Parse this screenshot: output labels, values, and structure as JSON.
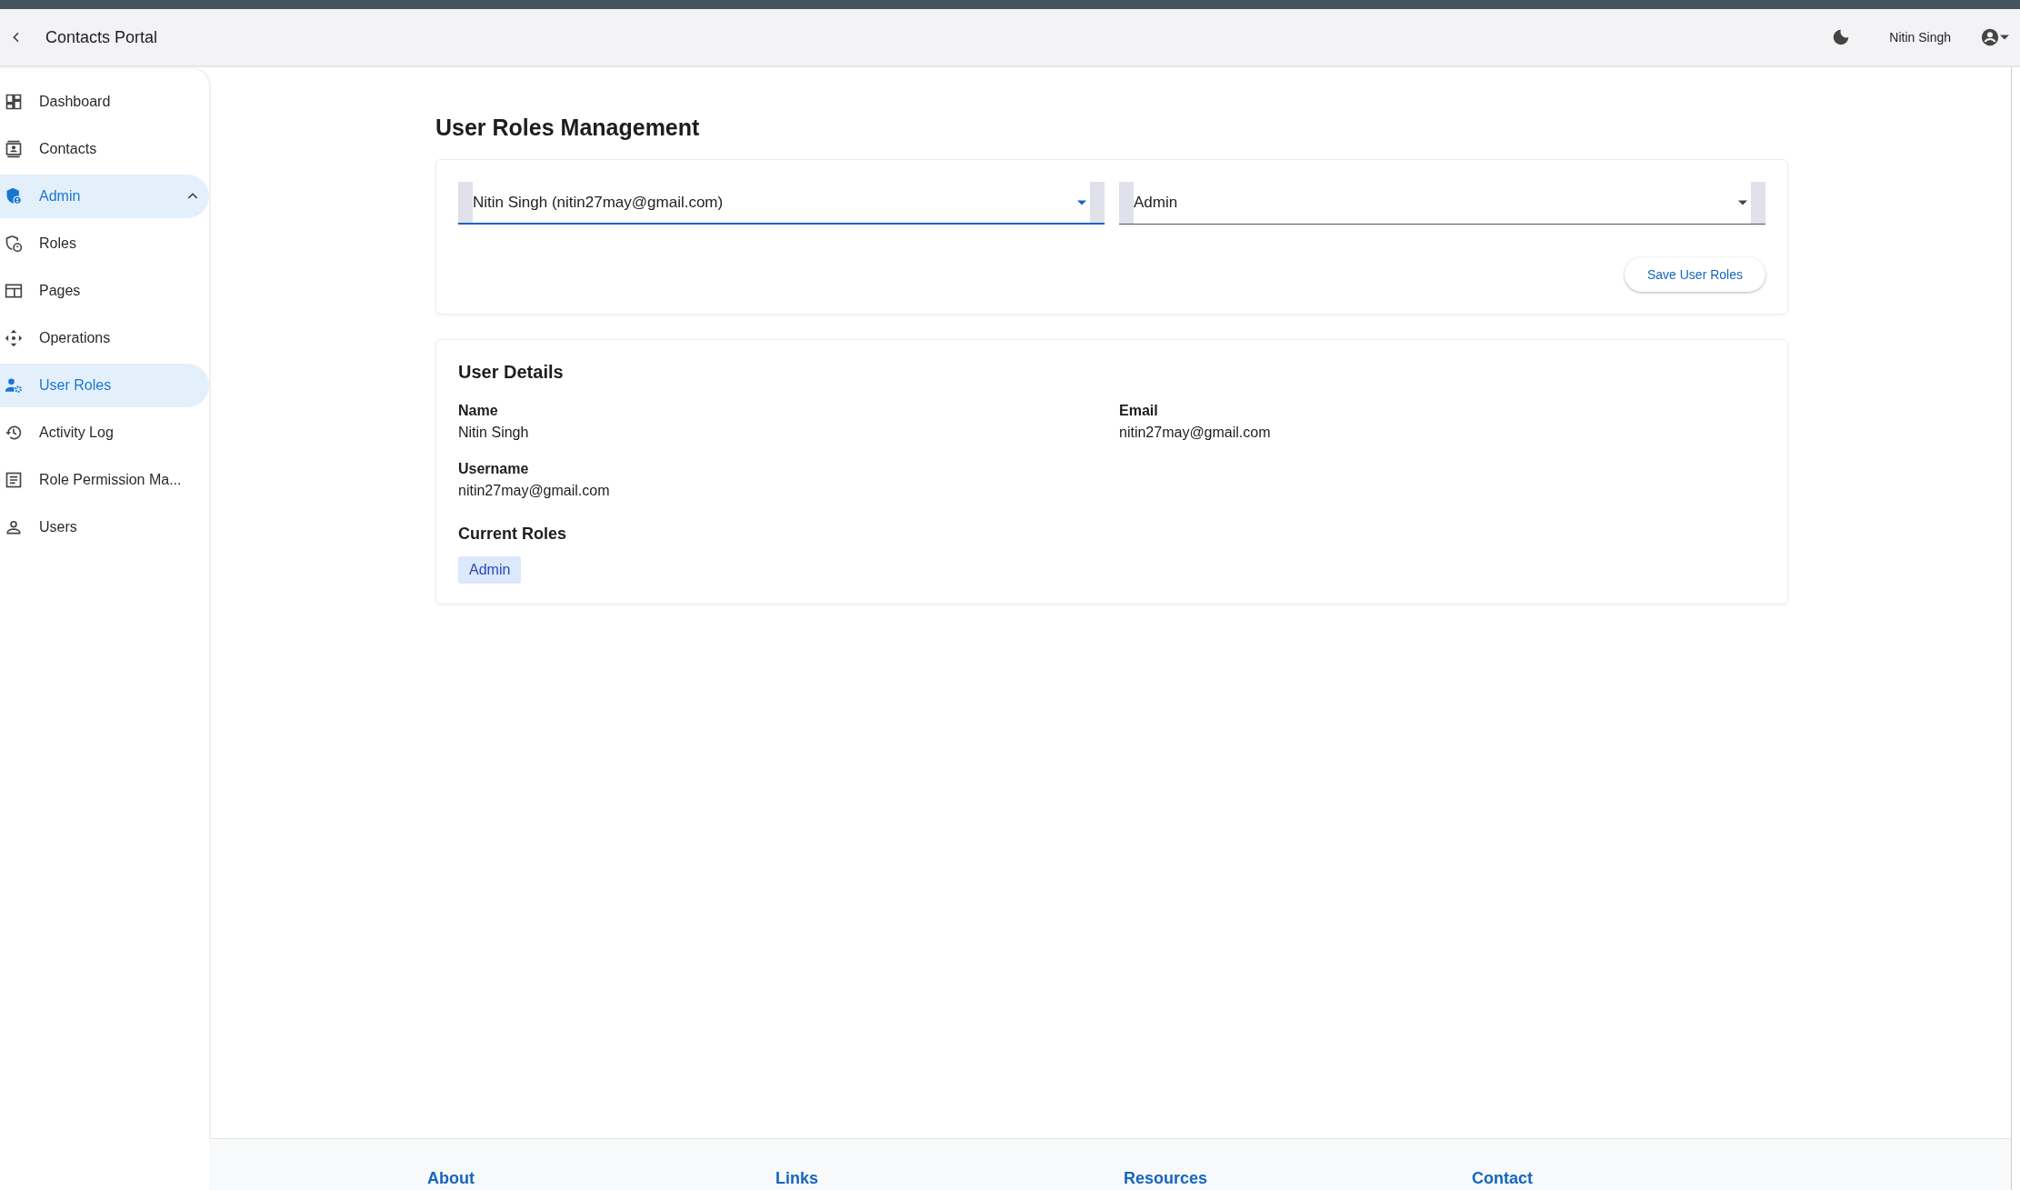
{
  "header": {
    "title": "Contacts Portal",
    "user_name": "Nitin Singh"
  },
  "sidebar": {
    "items": [
      {
        "label": "Dashboard",
        "selected": false
      },
      {
        "label": "Contacts",
        "selected": false
      },
      {
        "label": "Admin",
        "selected": true,
        "expanded": true,
        "children": [
          {
            "label": "Roles",
            "selected": false
          },
          {
            "label": "Pages",
            "selected": false
          },
          {
            "label": "Operations",
            "selected": false
          },
          {
            "label": "User Roles",
            "selected": true
          },
          {
            "label": "Activity Log",
            "selected": false
          },
          {
            "label": "Role Permission Ma...",
            "selected": false
          },
          {
            "label": "Users",
            "selected": false
          }
        ]
      }
    ]
  },
  "page_title": "User Roles Management",
  "form": {
    "selects": [
      {
        "value": "Nitin Singh (nitin27may@gmail.com)",
        "focused": true
      },
      {
        "value": "Admin",
        "focused": false
      }
    ],
    "save_button": "Save User Roles"
  },
  "user_details": {
    "title": "User Details",
    "fields": [
      {
        "label": "Name",
        "value": "Nitin Singh"
      },
      {
        "label": "Email",
        "value": "nitin27may@gmail.com"
      },
      {
        "label": "Username",
        "value": "nitin27may@gmail.com"
      }
    ],
    "roles_title": "Current Roles",
    "roles": [
      "Admin"
    ]
  },
  "footer": {
    "headings": [
      "About",
      "Links",
      "Resources",
      "Contact"
    ]
  }
}
